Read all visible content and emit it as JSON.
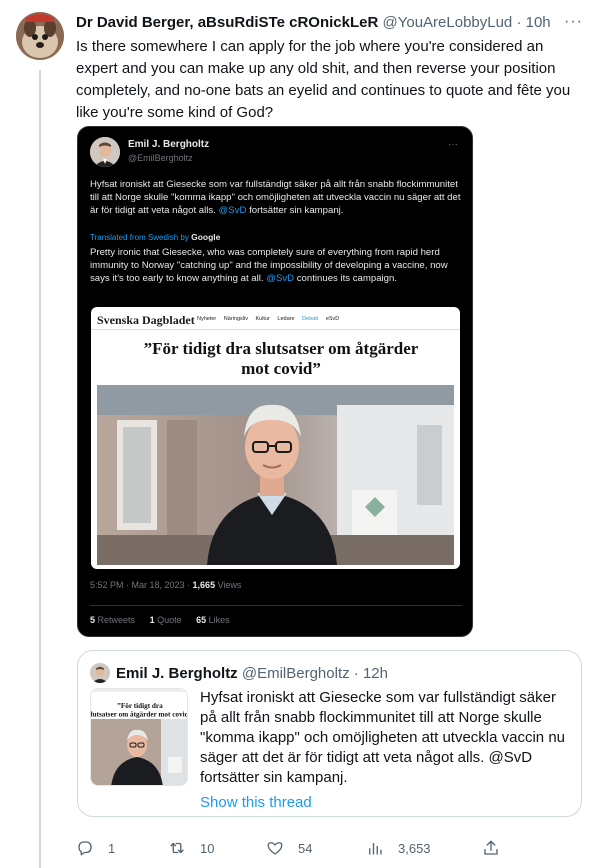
{
  "tweet": {
    "author_name": "Dr David Berger, aBsuRdiSTe cROnickLeR",
    "author_handle": "@YouAreLobbyLud",
    "separator": "·",
    "time": "10h",
    "more": "···",
    "text": "Is there somewhere I can apply for the job where you're considered an expert and you can make up any old shit, and then reverse your position completely, and no-one bats an eyelid and continues to quote and fête you like you're some kind of God?"
  },
  "embedded_screenshot": {
    "author_name": "Emil J. Bergholtz",
    "author_handle": "@EmilBergholtz",
    "more": "···",
    "text_before_mention": "Hyfsat ironiskt att Giesecke som var fullständigt säker på allt från snabb flockimmunitet till att Norge skulle \"komma ikapp\" och omöjligheten att utveckla vaccin nu säger att det är för tidigt att veta något alls. ",
    "mention": "@SvD",
    "text_after_mention": " fortsätter sin kampanj.",
    "translated_label": "Translated from Swedish by ",
    "translated_brand": "Google",
    "translation_before_mention": "Pretty ironic that Giesecke, who was completely sure of everything from rapid herd immunity to Norway \"catching up\" and the impossibility of developing a vaccine, now says it's too early to know anything at all. ",
    "translation_mention": "@SvD",
    "translation_after_mention": " continues its campaign.",
    "article": {
      "masthead": "Svenska Dagbladet",
      "nav": [
        "Nyheter",
        "Näringsliv",
        "Kultur",
        "Ledare",
        "Debatt",
        "eSvD"
      ],
      "active_nav": "Debatt",
      "headline": "”För tidigt dra slutsatser om åtgärder mot covid”"
    },
    "timestamp": "5:52 PM · Mar 18, 2023 · ",
    "views_count": "1,665",
    "views_label": " Views",
    "retweets_count": "5",
    "retweets_label": " Retweets",
    "quotes_count": "1",
    "quotes_label": " Quote",
    "likes_count": "65",
    "likes_label": " Likes"
  },
  "quoted_tweet": {
    "author_name": "Emil J. Bergholtz",
    "author_handle": "@EmilBergholtz",
    "separator": "·",
    "time": "12h",
    "thumb_headline": "”För tidigt dra slutsatser om åtgärder mot covid”",
    "text": "Hyfsat ironiskt att Giesecke som var fullständigt säker på allt från snabb flockimmunitet till att Norge skulle \"komma ikapp\" och omöjligheten att utveckla vaccin nu säger att det är för tidigt att veta något alls. @SvD fortsätter sin kampanj.",
    "show_thread": "Show this thread"
  },
  "actions": {
    "replies": "1",
    "retweets": "10",
    "likes": "54",
    "views": "3,653"
  },
  "colors": {
    "accent": "#1d9bf0",
    "muted": "#536471",
    "border": "#cfd9de"
  }
}
